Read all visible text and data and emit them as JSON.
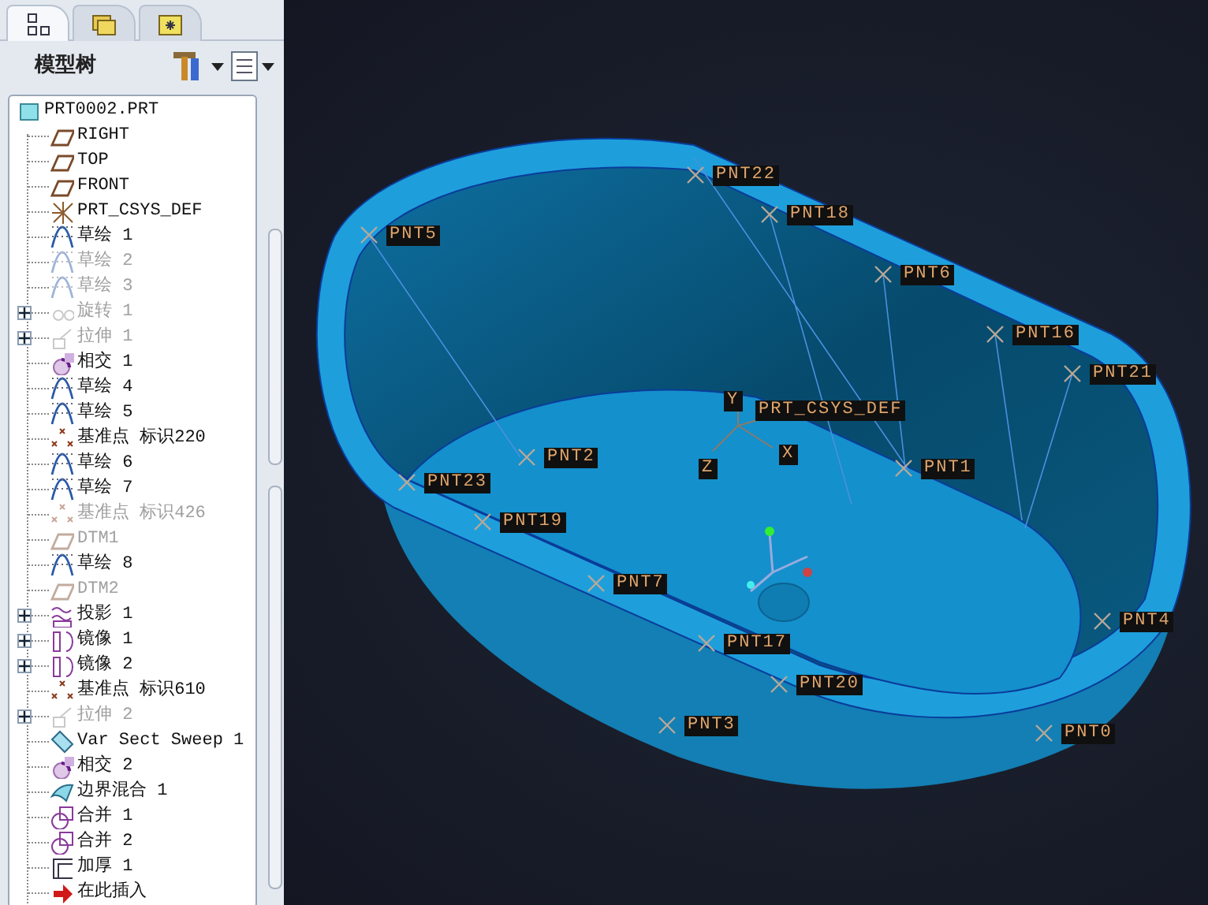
{
  "tabs": [
    {
      "selected": true
    },
    {
      "selected": false
    },
    {
      "selected": false
    }
  ],
  "panel": {
    "title": "模型树"
  },
  "tree": {
    "label": "PRT0002.PRT",
    "kind": "part",
    "disabled": false,
    "children": [
      {
        "label": "RIGHT",
        "kind": "plane",
        "disabled": false
      },
      {
        "label": "TOP",
        "kind": "plane",
        "disabled": false
      },
      {
        "label": "FRONT",
        "kind": "plane",
        "disabled": false
      },
      {
        "label": "PRT_CSYS_DEF",
        "kind": "csys",
        "disabled": false
      },
      {
        "label": "草绘 1",
        "kind": "sketch",
        "disabled": false
      },
      {
        "label": "草绘 2",
        "kind": "sketch",
        "disabled": true
      },
      {
        "label": "草绘 3",
        "kind": "sketch",
        "disabled": true
      },
      {
        "label": "旋转 1",
        "kind": "revolve",
        "disabled": true,
        "expanded": false
      },
      {
        "label": "拉伸 1",
        "kind": "extrude",
        "disabled": true,
        "expanded": false
      },
      {
        "label": "相交 1",
        "kind": "intersect",
        "disabled": false
      },
      {
        "label": "草绘 4",
        "kind": "sketch",
        "disabled": false
      },
      {
        "label": "草绘 5",
        "kind": "sketch",
        "disabled": false
      },
      {
        "label": "基准点 标识220",
        "kind": "point",
        "disabled": false
      },
      {
        "label": "草绘 6",
        "kind": "sketch",
        "disabled": false
      },
      {
        "label": "草绘 7",
        "kind": "sketch",
        "disabled": false
      },
      {
        "label": "基准点 标识426",
        "kind": "point",
        "disabled": true
      },
      {
        "label": "DTM1",
        "kind": "plane",
        "disabled": true
      },
      {
        "label": "草绘 8",
        "kind": "sketch",
        "disabled": false
      },
      {
        "label": "DTM2",
        "kind": "plane",
        "disabled": true
      },
      {
        "label": "投影 1",
        "kind": "projection",
        "disabled": false,
        "expanded": false
      },
      {
        "label": "镜像 1",
        "kind": "mirror",
        "disabled": false,
        "expanded": false
      },
      {
        "label": "镜像 2",
        "kind": "mirror",
        "disabled": false,
        "expanded": false
      },
      {
        "label": "基准点 标识610",
        "kind": "point",
        "disabled": false
      },
      {
        "label": "拉伸 2",
        "kind": "extrude",
        "disabled": true,
        "expanded": false
      },
      {
        "label": "Var Sect Sweep 1",
        "kind": "sweep",
        "disabled": false
      },
      {
        "label": "相交 2",
        "kind": "intersect",
        "disabled": false
      },
      {
        "label": "边界混合 1",
        "kind": "boundary",
        "disabled": false
      },
      {
        "label": "合并 1",
        "kind": "merge",
        "disabled": false
      },
      {
        "label": "合并 2",
        "kind": "merge",
        "disabled": false
      },
      {
        "label": "加厚 1",
        "kind": "thicken",
        "disabled": false
      },
      {
        "label": "在此插入",
        "kind": "insert",
        "disabled": false
      }
    ]
  },
  "viewport": {
    "csys": {
      "label": "PRT_CSYS_DEF",
      "axes": [
        "Y",
        "X",
        "Z"
      ]
    },
    "points": [
      {
        "label": "PNT22"
      },
      {
        "label": "PNT18"
      },
      {
        "label": "PNT5"
      },
      {
        "label": "PNT6"
      },
      {
        "label": "PNT16"
      },
      {
        "label": "PNT21"
      },
      {
        "label": "PNT2"
      },
      {
        "label": "PNT1"
      },
      {
        "label": "PNT23"
      },
      {
        "label": "PNT19"
      },
      {
        "label": "PNT7"
      },
      {
        "label": "PNT4"
      },
      {
        "label": "PNT17"
      },
      {
        "label": "PNT20"
      },
      {
        "label": "PNT3"
      },
      {
        "label": "PNT0"
      }
    ]
  }
}
